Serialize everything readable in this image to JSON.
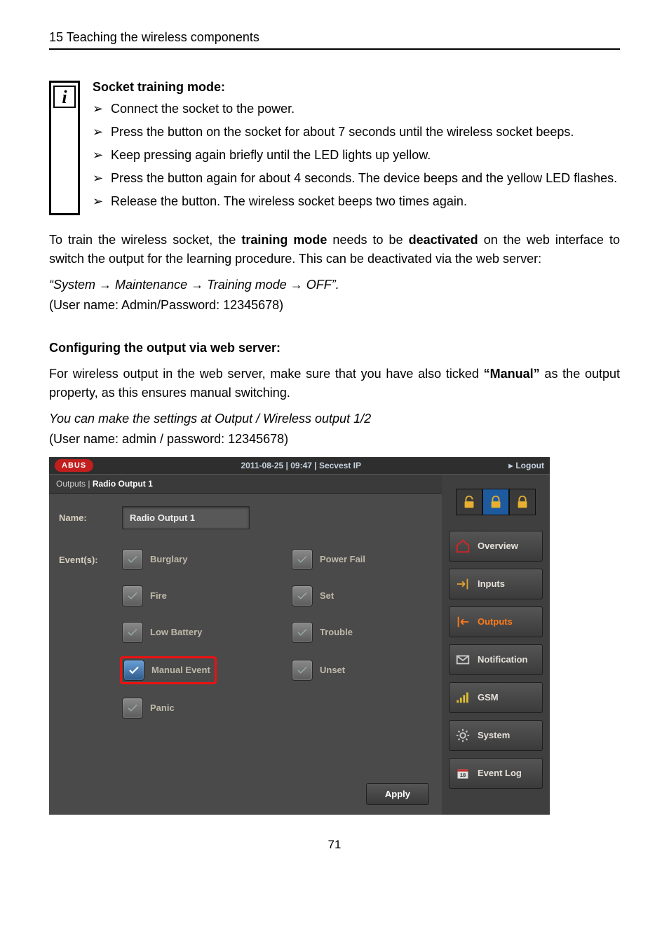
{
  "page_header": "15  Teaching the wireless components",
  "info": {
    "title": "Socket training mode:",
    "steps": [
      "Connect the socket to the power.",
      "Press the button on the socket for about 7 seconds until the wireless socket beeps.",
      "Keep pressing again briefly until the LED lights up yellow.",
      "Press the button again for about 4 seconds. The device beeps and the yellow LED flashes.",
      "Release the button. The wireless socket beeps two times again."
    ]
  },
  "para1_a": "To train the wireless socket, the ",
  "para1_b": "training mode",
  "para1_c": " needs to be ",
  "para1_d": "deactivated",
  "para1_e": " on the web interface to switch the output for the learning procedure. This can be deactivated via the web server:",
  "path_line": "“System → Maintenance → Training mode → OFF”.",
  "creds1": "(User name: Admin/Password: 12345678)",
  "config_heading": "Configuring the output via web server:",
  "para2_a": "For wireless output in the web server, make sure that you have also ticked ",
  "para2_b": "“Manual”",
  "para2_c": " as the output property, as this ensures manual switching.",
  "settings_line": "You can make the settings at Output / Wireless output 1/2",
  "creds2": "(User name: admin / password: 12345678)",
  "page_number": "71",
  "app": {
    "logo": "ABUS",
    "header_center": "2011-08-25  |  09:47  |  Secvest IP",
    "logout": "Logout",
    "breadcrumb_a": "Outputs | ",
    "breadcrumb_b": "Radio Output 1",
    "name_label": "Name:",
    "name_value": "Radio Output 1",
    "events_label": "Event(s):",
    "events": {
      "burglary": "Burglary",
      "powerfail": "Power Fail",
      "fire": "Fire",
      "set": "Set",
      "lowbatt": "Low Battery",
      "trouble": "Trouble",
      "manual": "Manual Event",
      "unset": "Unset",
      "panic": "Panic"
    },
    "apply": "Apply",
    "nav": {
      "overview": "Overview",
      "inputs": "Inputs",
      "outputs": "Outputs",
      "notification": "Notification",
      "gsm": "GSM",
      "system": "System",
      "eventlog": "Event Log"
    }
  }
}
